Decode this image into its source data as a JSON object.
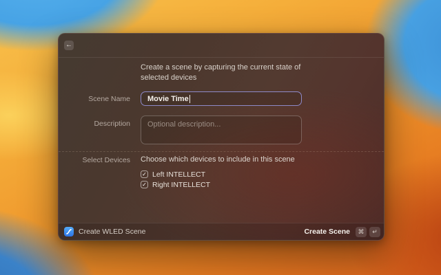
{
  "header": {
    "back_icon": "←"
  },
  "form": {
    "intro": "Create a scene by capturing the current state of selected devices",
    "scene_name": {
      "label": "Scene Name",
      "value": "Movie Time"
    },
    "description": {
      "label": "Description",
      "placeholder": "Optional description..."
    },
    "select_devices": {
      "label": "Select Devices",
      "hint": "Choose which devices to include in this scene",
      "devices": [
        {
          "name": "Left INTELLECT",
          "checked": true,
          "check_icon": "✓"
        },
        {
          "name": "Right INTELLECT",
          "checked": true,
          "check_icon": "✓"
        }
      ]
    }
  },
  "footer": {
    "app_name": "Create WLED Scene",
    "primary_action": "Create Scene",
    "shortcut_keys": [
      "⌘",
      "↵"
    ]
  },
  "colors": {
    "accent_blue": "#3b82f6",
    "input_focus_border": "#8e8ac9",
    "wallpaper_blue": "#47a3e5",
    "wallpaper_orange": "#ef982d"
  }
}
